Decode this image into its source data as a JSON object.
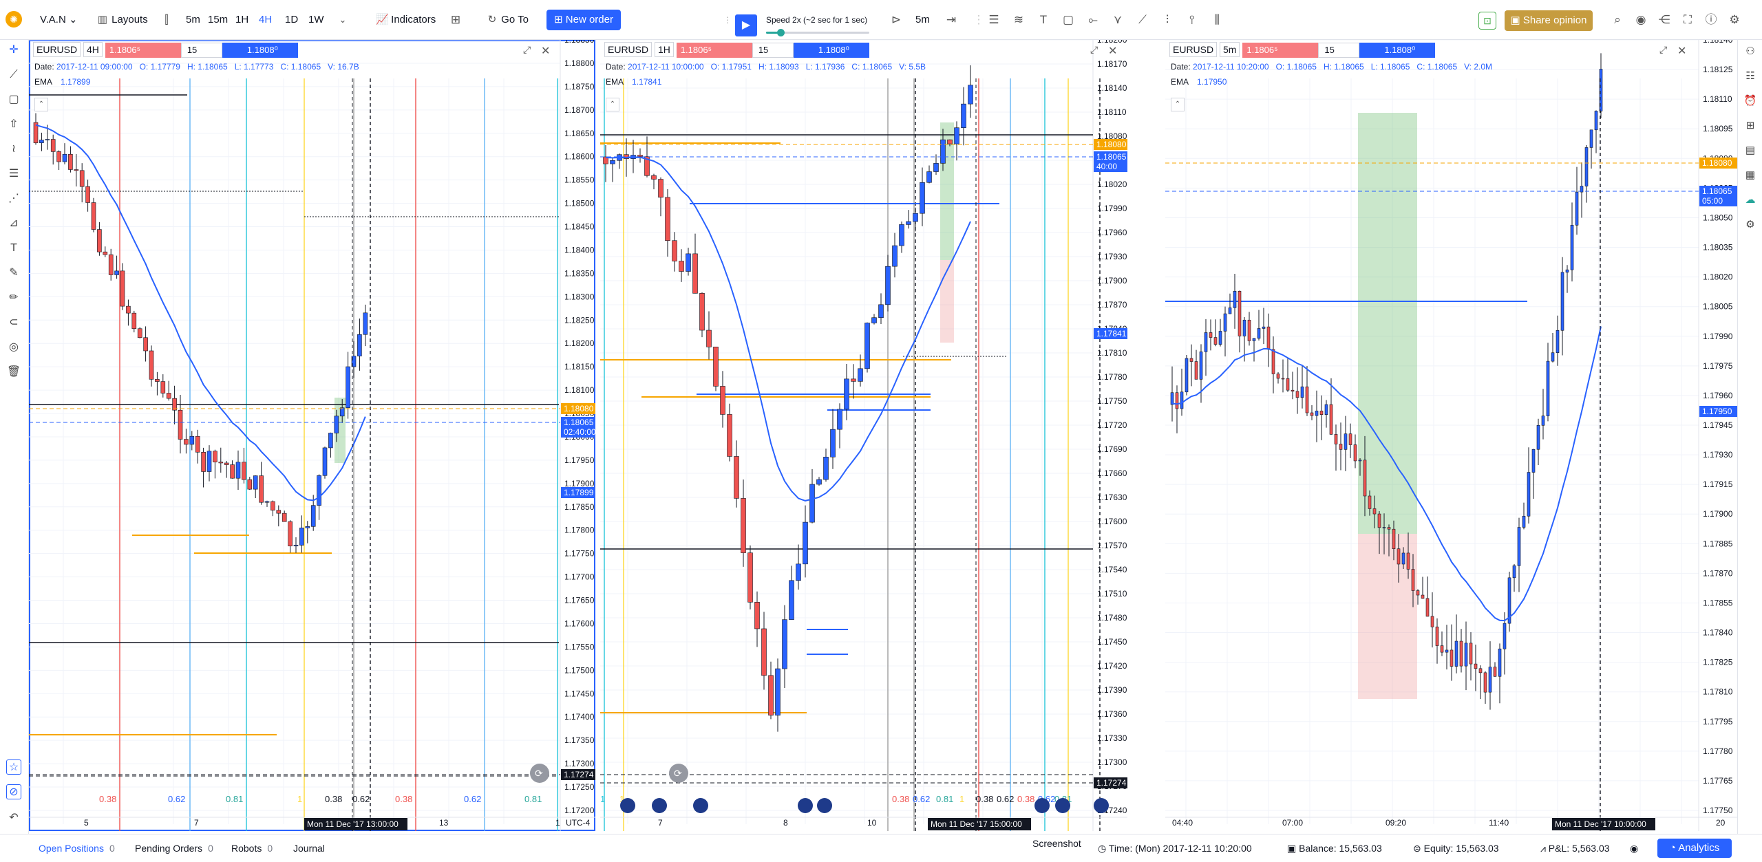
{
  "toolbar": {
    "account": "V.A.N",
    "layouts": "Layouts",
    "timeframes": [
      "5m",
      "15m",
      "1H",
      "4H",
      "1D",
      "1W"
    ],
    "active_timeframe": "4H",
    "indicators": "Indicators",
    "goto": "Go To",
    "new_order": "New order",
    "speed": "Speed 2x (~2 sec for 1 sec)",
    "replay_tf": "5m",
    "share": "Share opinion"
  },
  "panels": [
    {
      "symbol": "EURUSD",
      "tf": "4H",
      "sell": "1.1806⁵",
      "qty": "15",
      "buy": "1.1808⁰",
      "date_label": "Date:",
      "date": "2017-12-11 09:00:00",
      "o": "O: 1.17779",
      "h": "H: 1.18065",
      "l": "L: 1.17773",
      "c": "C: 1.18065",
      "vol": "V: 16.7B",
      "ema_label": "EMA",
      "ema": "1.17899",
      "axis_ticks": [
        "1.18850",
        "1.18800",
        "1.18750",
        "1.18700",
        "1.18650",
        "1.18600",
        "1.18550",
        "1.18500",
        "1.18450",
        "1.18400",
        "1.18350",
        "1.18300",
        "1.18250",
        "1.18200",
        "1.18150",
        "1.18100",
        "1.18050",
        "1.18000",
        "1.17950",
        "1.17900",
        "1.17850",
        "1.17800",
        "1.17750",
        "1.17700",
        "1.17650",
        "1.17600",
        "1.17550",
        "1.17500",
        "1.17450",
        "1.17400",
        "1.17350",
        "1.17300",
        "1.17250",
        "1.17200"
      ],
      "price_tags": {
        "orange": "1.18080",
        "blue": "1.18065",
        "countdown": "02:40:00",
        "ema": "1.17899",
        "bottom": "1.17274"
      },
      "x_ticks": [
        "5",
        "7",
        "8",
        "13",
        "1"
      ],
      "crosshair_time": "Mon 11 Dec '17 13:00:00",
      "tz": "UTC-4",
      "fibs": [
        "0.38",
        "0.62",
        "0.81",
        "1",
        "0.38",
        "0.62",
        "0.38",
        "0.62",
        "0.81"
      ]
    },
    {
      "symbol": "EURUSD",
      "tf": "1H",
      "sell": "1.1806⁵",
      "qty": "15",
      "buy": "1.1808⁰",
      "date_label": "Date:",
      "date": "2017-12-11 10:00:00",
      "o": "O: 1.17951",
      "h": "H: 1.18093",
      "l": "L: 1.17936",
      "c": "C: 1.18065",
      "vol": "V: 5.5B",
      "ema_label": "EMA",
      "ema": "1.17841",
      "axis_ticks": [
        "1.18200",
        "1.18170",
        "1.18140",
        "1.18110",
        "1.18080",
        "1.18050",
        "1.18020",
        "1.17990",
        "1.17960",
        "1.17930",
        "1.17900",
        "1.17870",
        "1.17840",
        "1.17810",
        "1.17780",
        "1.17750",
        "1.17720",
        "1.17690",
        "1.17660",
        "1.17630",
        "1.17600",
        "1.17570",
        "1.17540",
        "1.17510",
        "1.17480",
        "1.17450",
        "1.17420",
        "1.17390",
        "1.17360",
        "1.17330",
        "1.17300",
        "1.17270",
        "1.17240"
      ],
      "price_tags": {
        "orange": "1.18080",
        "blue": "1.18065",
        "countdown": "40:00",
        "ema": "1.17841",
        "bottom": "1.17274"
      },
      "x_ticks": [
        "7",
        "8",
        "10"
      ],
      "crosshair_time": "Mon 11 Dec '17 15:00:00",
      "tz": "",
      "fibs": [
        "1",
        "1",
        "0.38",
        "0.62",
        "0.81",
        "1",
        "0.38",
        "0.62",
        "0.38",
        "0.62",
        "0.81"
      ]
    },
    {
      "symbol": "EURUSD",
      "tf": "5m",
      "sell": "1.1806⁵",
      "qty": "15",
      "buy": "1.1808⁰",
      "date_label": "Date:",
      "date": "2017-12-11 10:20:00",
      "o": "O: 1.18065",
      "h": "H: 1.18065",
      "l": "L: 1.18065",
      "c": "C: 1.18065",
      "vol": "V: 2.0M",
      "ema_label": "EMA",
      "ema": "1.17950",
      "axis_ticks": [
        "1.18140",
        "1.18125",
        "1.18110",
        "1.18095",
        "1.18080",
        "1.18065",
        "1.18050",
        "1.18035",
        "1.18020",
        "1.18005",
        "1.17990",
        "1.17975",
        "1.17960",
        "1.17945",
        "1.17930",
        "1.17915",
        "1.17900",
        "1.17885",
        "1.17870",
        "1.17855",
        "1.17840",
        "1.17825",
        "1.17810",
        "1.17795",
        "1.17780",
        "1.17765",
        "1.17750"
      ],
      "price_tags": {
        "orange": "1.18080",
        "blue": "1.18065",
        "countdown": "05:00",
        "ema": "1.17950"
      },
      "x_ticks": [
        "04:40",
        "07:00",
        "09:20",
        "11:40",
        "20"
      ],
      "crosshair_time": "Mon 11 Dec '17 10:00:00",
      "tz": ""
    }
  ],
  "bottom": {
    "open_positions": "Open Positions",
    "open_count": "0",
    "pending": "Pending Orders",
    "pending_count": "0",
    "robots": "Robots",
    "robots_count": "0",
    "journal": "Journal",
    "screenshot": "Screenshot",
    "time": "Time: (Mon) 2017-12-11 10:20:00",
    "balance": "Balance: 15,563.03",
    "equity": "Equity: 15,563.03",
    "pnl": "P&L: 5,563.03",
    "analytics": "Analytics"
  },
  "colors": {
    "up": "#2962ff",
    "down": "#ef5350",
    "ema": "#2962ff",
    "accent": "#2962ff",
    "orange": "#f7a600"
  }
}
